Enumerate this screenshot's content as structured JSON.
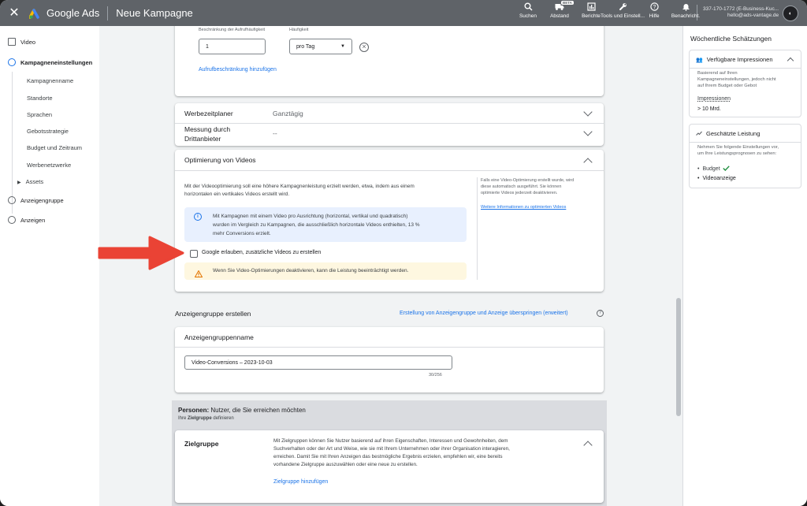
{
  "topbar": {
    "close": "✕",
    "brand": "Google Ads",
    "title": "Neue Kampagne",
    "tools": [
      {
        "label": "Suchen",
        "icon": "search-icon",
        "glyph": "⌕"
      },
      {
        "label": "Abstand",
        "icon": "truck-icon",
        "glyph": "⛟",
        "badge": "BETA"
      },
      {
        "label": "Berichte",
        "icon": "reports-icon",
        "glyph": "▥"
      },
      {
        "label": "Tools und Einstell...",
        "icon": "wrench-icon",
        "glyph": "✎"
      },
      {
        "label": "Hilfe",
        "icon": "help-icon",
        "glyph": "?"
      },
      {
        "label": "Benachricht.",
        "icon": "bell-icon",
        "glyph": "♪"
      }
    ],
    "account_id": "337-170-1772 (E-Business-Kuc...",
    "account_email": "hello@ads-vantage.de",
    "avatar_text": "◐"
  },
  "leftnav": {
    "video": "Video",
    "campaign_settings": "Kampagneneinstellungen",
    "sub": [
      "Kampagnenname",
      "Standorte",
      "Sprachen",
      "Gebotsstrategie",
      "Budget und Zeitraum",
      "Werbenetzwerke"
    ],
    "assets": "Assets",
    "ad_group": "Anzeigengruppe",
    "ads": "Anzeigen"
  },
  "frequency": {
    "limit_label": "Beschränkung der Aufrufhäufigkeit",
    "frequency_label": "Häufigkeit",
    "limit_value": "1",
    "frequency_value": "pro Tag",
    "add_link": "Aufrufbeschränkung hinzufügen"
  },
  "rows": {
    "schedule_title": "Werbezeitplaner",
    "schedule_value": "Ganztägig",
    "measurement_title_1": "Messung durch",
    "measurement_title_2": "Drittanbieter",
    "measurement_value": "--"
  },
  "video_opt": {
    "title": "Optimierung von Videos",
    "desc_1": "Mit der Videooptimierung soll eine höhere Kampagnenleistung erzielt werden, etwa, indem aus einem",
    "desc_2": "horizontalen ein vertikales Videos erstellt wird.",
    "info_1": "Mit Kampagnen mit einem Video pro Ausrichtung (horizontal, vertikal und quadratisch)",
    "info_2": "wurden im Vergleich zu Kampagnen, die ausschließlich horizontale Videos enthielten, 13 %",
    "info_3": "mehr Conversions erzielt.",
    "checkbox_label": "Google erlauben, zusätzliche Videos zu erstellen",
    "warning": "Wenn Sie Video-Optimierungen deaktivieren, kann die Leistung beeinträchtigt werden.",
    "side_1": "Falls eine Video-Optimierung erstellt wurde, wird",
    "side_2": "diese automatisch ausgeführt. Sie können",
    "side_3": "optimierte Videos jederzeit deaktivieren.",
    "side_link": "Weitere Informationen zu optimierten Videos"
  },
  "ad_group": {
    "section_title": "Anzeigengruppe erstellen",
    "skip_link": "Erstellung von Anzeigengruppe und Anzeige überspringen (erweitert)",
    "name_label": "Anzeigengruppenname",
    "name_value": "Video-Conversions – 2023-10-03",
    "counter": "30/256"
  },
  "people": {
    "title_bold": "Personen:",
    "title_rest": " Nutzer, die Sie erreichen möchten",
    "sub_pre": "Ihre ",
    "sub_bold": "Zielgruppe",
    "sub_post": " definieren",
    "audience_title": "Zielgruppe",
    "audience_desc_1": "Mit Zielgruppen können Sie Nutzer basierend auf ihren Eigenschaften, Interessen und Gewohnheiten, dem",
    "audience_desc_2": "Suchverhalten oder der Art und Weise, wie sie mit Ihrem Unternehmen oder ihrer Organisation interagieren,",
    "audience_desc_3": "erreichen. Damit Sie mit Ihren Anzeigen das bestmögliche Ergebnis erzielen, empfehlen wir, eine bereits",
    "audience_desc_4": "vorhandene Zielgruppe auszuwählen oder eine neue zu erstellen.",
    "add_link": "Zielgruppe hinzufügen"
  },
  "rightpanel": {
    "title": "Wöchentliche Schätzungen",
    "imp_title": "Verfügbare Impressionen",
    "imp_desc_1": "Basierend auf Ihren",
    "imp_desc_2": "Kampagneneinstellungen, jedoch nicht",
    "imp_desc_3": "auf Ihrem Budget oder Gebot",
    "imp_label": "Impressionen",
    "imp_value": "> 10 Mrd.",
    "perf_title": "Geschätzte Leistung",
    "perf_desc_1": "Nehmen Sie folgende Einstellungen vor,",
    "perf_desc_2": "um Ihre Leistungsprognosen zu sehen:",
    "perf_items": [
      "Budget",
      "Videoanzeige"
    ]
  },
  "colors": {
    "topbar": "#5f6368",
    "accent": "#1a73e8",
    "arrow": "#ea4335",
    "info_bg": "#e8f0fe",
    "warn_bg": "#fef7e0",
    "check_green": "#1e8e3e"
  }
}
